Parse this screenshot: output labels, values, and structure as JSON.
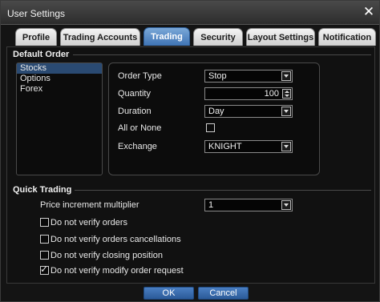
{
  "window": {
    "title": "User Settings",
    "close_glyph": "✕"
  },
  "tabs": [
    {
      "label": "Profile"
    },
    {
      "label": "Trading Accounts"
    },
    {
      "label": "Trading"
    },
    {
      "label": "Security"
    },
    {
      "label": "Layout Settings"
    },
    {
      "label": "Notification"
    }
  ],
  "active_tab": "Trading",
  "default_order": {
    "section_label": "Default Order",
    "asset_list": [
      "Stocks",
      "Options",
      "Forex"
    ],
    "selected_asset": "Stocks",
    "fields": {
      "order_type": {
        "label": "Order Type",
        "value": "Stop"
      },
      "quantity": {
        "label": "Quantity",
        "value": "100"
      },
      "duration": {
        "label": "Duration",
        "value": "Day"
      },
      "all_or_none": {
        "label": "All or None",
        "checked": false
      },
      "exchange": {
        "label": "Exchange",
        "value": "KNIGHT"
      }
    }
  },
  "quick_trading": {
    "section_label": "Quick Trading",
    "price_increment": {
      "label": "Price increment multiplier",
      "value": "1"
    },
    "options": [
      {
        "label": "Do not verify orders",
        "checked": false
      },
      {
        "label": "Do not verify orders cancellations",
        "checked": false
      },
      {
        "label": "Do not verify closing position",
        "checked": false
      },
      {
        "label": "Do not verify modify order request",
        "checked": true
      }
    ]
  },
  "buttons": {
    "ok": "OK",
    "cancel": "Cancel"
  },
  "colors": {
    "accent": "#3f73b4",
    "background": "#111111",
    "selected_item": "#2a4a72"
  }
}
